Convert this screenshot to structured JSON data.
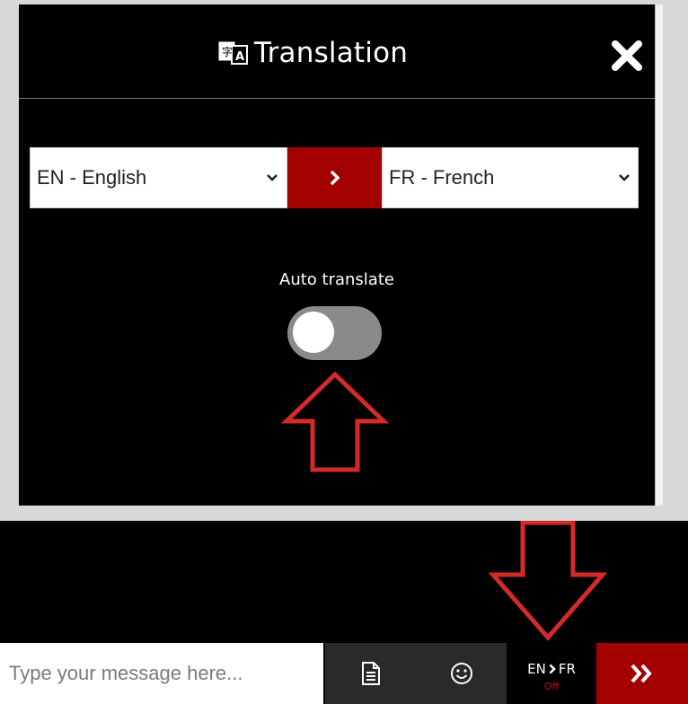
{
  "translation_panel": {
    "title": "Translation",
    "title_icon": "translate-icon",
    "close_icon": "close-icon",
    "source_language": "EN - English",
    "target_language": "FR - French",
    "swap_icon": "chevron-right-icon",
    "auto_translate_label": "Auto translate",
    "auto_translate_on": false
  },
  "chat_bar": {
    "message_placeholder": "Type your message here...",
    "attach_icon": "document-icon",
    "emoji_icon": "smiley-icon",
    "lang_pair": {
      "from": "EN",
      "to": "FR",
      "status": "Off"
    },
    "send_icon": "double-chevron-right-icon"
  },
  "colors": {
    "accent": "#a30000",
    "panel_bg": "#000000",
    "annotation_arrow": "#d42a2a",
    "status_off": "#d60000"
  }
}
